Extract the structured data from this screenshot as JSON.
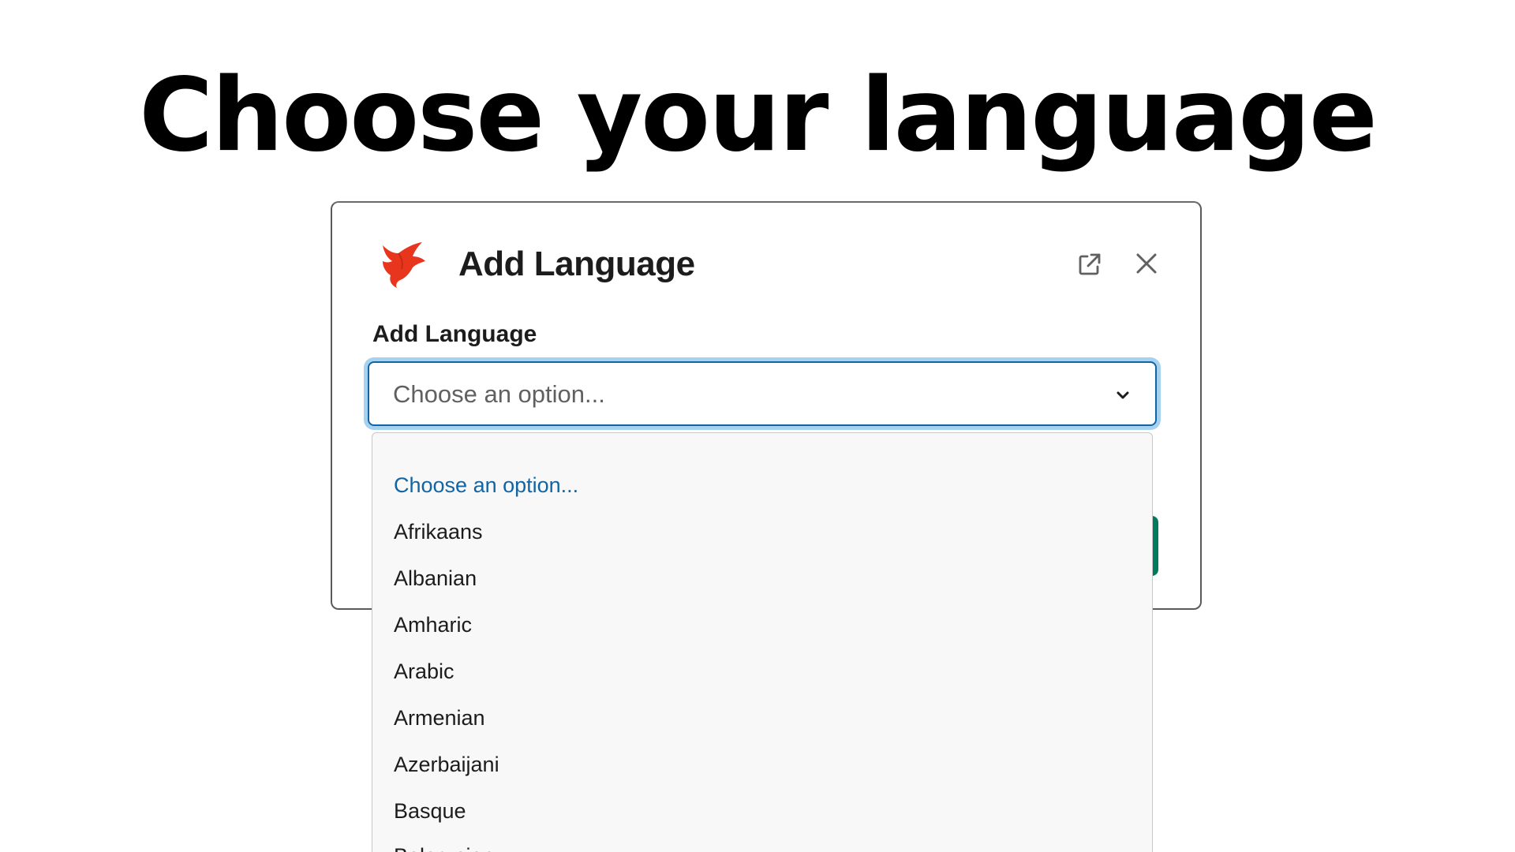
{
  "headline": "Choose your language",
  "dialog": {
    "title": "Add Language",
    "field_label": "Add Language",
    "select": {
      "value": "Choose an option..."
    },
    "options": [
      "Choose an option...",
      "Afrikaans",
      "Albanian",
      "Amharic",
      "Arabic",
      "Armenian",
      "Azerbaijani",
      "Basque",
      "Belarusian"
    ],
    "icons": {
      "brand": "phoenix-bird-icon",
      "popout": "open-external-icon",
      "close": "close-icon",
      "chevron": "chevron-down-icon"
    }
  },
  "colors": {
    "accent": "#1264a3",
    "focus_ring": "#a6d2f0",
    "submit_green": "#007a5a",
    "brand_red": "#e8351d",
    "text_primary": "#1d1c1d",
    "text_placeholder": "#616061",
    "list_bg": "#f8f8f8"
  }
}
